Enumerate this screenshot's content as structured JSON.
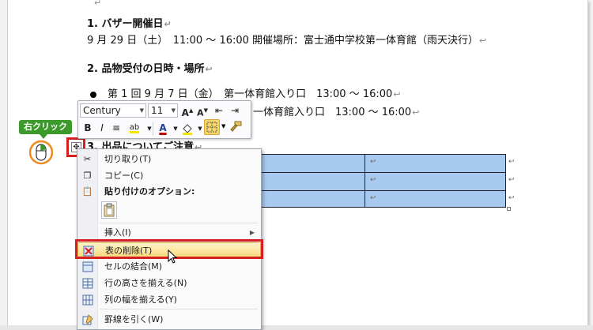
{
  "document": {
    "section1_heading": "1. バザー開催日",
    "section1_body": "9 月 29 日（土）　11:00 ～ 16:00 開催場所：富士通中学校第一体育館（雨天決行）",
    "section2_heading": "2. 品物受付の日時・場所",
    "bullet1": "第 1 回 9 月 7 日（金）　第一体育館入り口　13:00 ～ 16:00",
    "bullet2_visible": "一体育館入り口　13:00 ～ 16:00",
    "section3_heading": "3. 出品についてご注意",
    "paragraph_mark": "↵",
    "cell_mark": "↩"
  },
  "callout": {
    "label": "右クリック"
  },
  "mini_toolbar": {
    "font_name": "Century",
    "font_size": "11",
    "grow_font_label": "A",
    "shrink_font_label": "A",
    "bold_label": "B",
    "italic_label": "I",
    "font_color_label": "A",
    "highlight_label": "ab"
  },
  "context_menu": {
    "items": [
      {
        "icon": "scissors-icon",
        "label": "切り取り(T)"
      },
      {
        "icon": "copy-icon",
        "label": "コピー(C)"
      },
      {
        "icon": "paste-options-icon",
        "label": "貼り付けのオプション:"
      },
      {
        "icon": "insert-icon",
        "label": "挿入(I)"
      },
      {
        "icon": "delete-table-icon",
        "label": "表の削除(T)"
      },
      {
        "icon": "merge-cells-icon",
        "label": "セルの結合(M)"
      },
      {
        "icon": "distribute-rows-icon",
        "label": "行の高さを揃える(N)"
      },
      {
        "icon": "distribute-columns-icon",
        "label": "列の幅を揃える(Y)"
      },
      {
        "icon": "draw-borders-icon",
        "label": "罫線を引く(W)"
      }
    ]
  },
  "colors": {
    "accent_red": "#d42020",
    "callout_green": "#3c9a2c",
    "selection_blue": "#a7c8ef"
  }
}
